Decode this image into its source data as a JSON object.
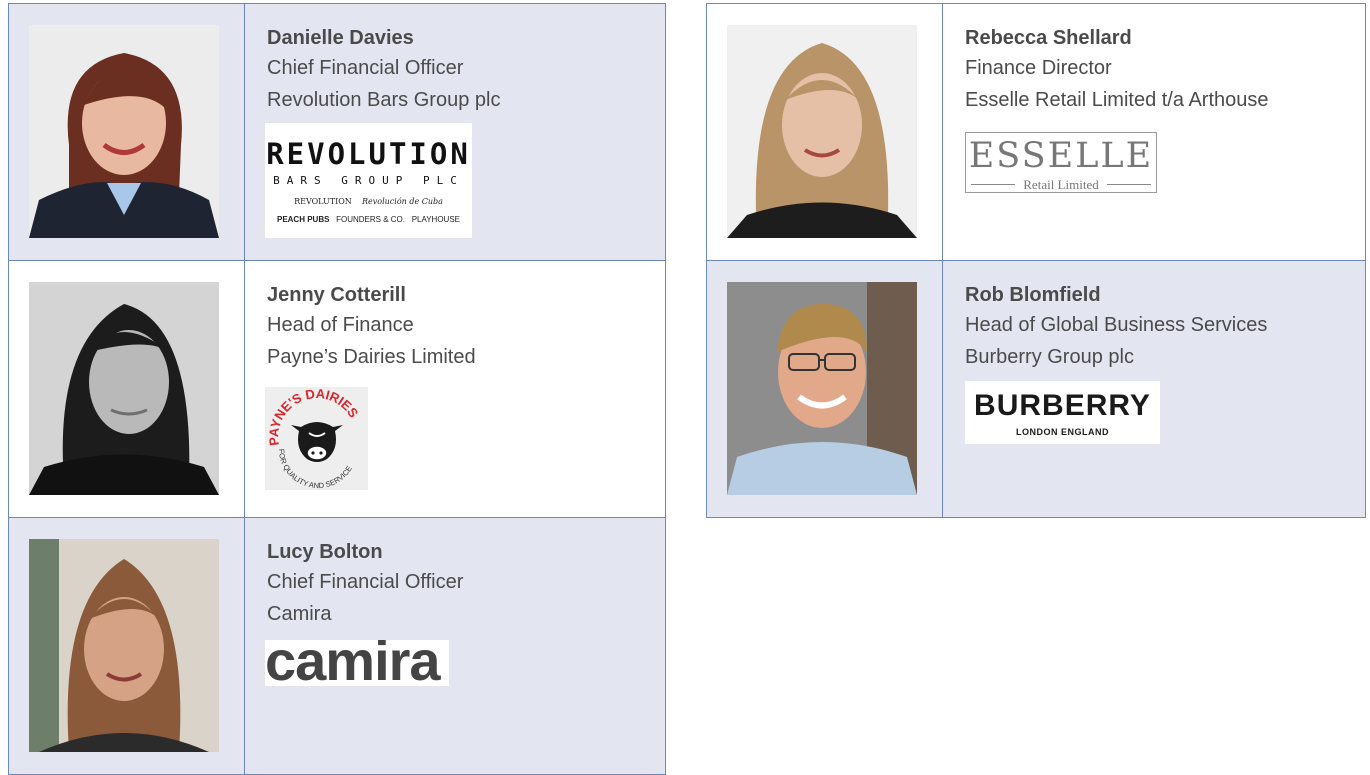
{
  "people": [
    {
      "name": "Danielle Davies",
      "role": "Chief Financial Officer",
      "company": "Revolution Bars Group plc",
      "logo": {
        "main": "REVOLUTION",
        "sub": "BARS GROUP PLC",
        "brands_row1": [
          "REVOLUTION",
          "Revolución de Cuba"
        ],
        "brands_row2": [
          "PEACH PUBS",
          "FOUNDERS & CO.",
          "PLAYHOUSE"
        ]
      }
    },
    {
      "name": "Jenny Cotterill",
      "role": "Head of Finance",
      "company": "Payne’s Dairies Limited",
      "logo": {
        "top": "PAYNE'S DAIRIES",
        "bottom": "FOR QUALITY AND SERVICE"
      }
    },
    {
      "name": "Lucy Bolton",
      "role": "Chief Financial Officer",
      "company": "Camira",
      "logo": {
        "main": "camira"
      }
    },
    {
      "name": "Rebecca Shellard",
      "role": "Finance Director",
      "company": "Esselle Retail Limited t/a Arthouse",
      "logo": {
        "main": "ESSELLE",
        "sub": "Retail Limited"
      }
    },
    {
      "name": "Rob Blomfield",
      "role": "Head of Global Business Services",
      "company": "Burberry Group plc",
      "logo": {
        "main": "BURBERRY",
        "sub": "LONDON ENGLAND"
      }
    }
  ],
  "colors": {
    "border": "#6c87bb",
    "shade": "#e3e6f1",
    "text": "#4b4b4b",
    "dairy_red": "#d7262e"
  }
}
